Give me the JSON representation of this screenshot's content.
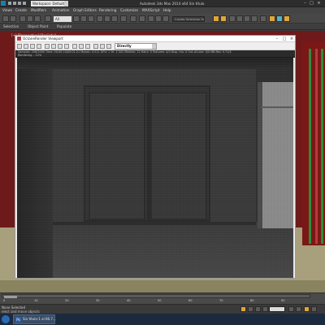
{
  "titlebar": {
    "workspace_value": "Workspace: Default",
    "app_title": "Autodesk 3ds Max 2014 x64    Sin título"
  },
  "menubar": {
    "items": [
      "Views",
      "Create",
      "Modifiers",
      "Animation",
      "Graph Editors",
      "Rendering",
      "Customize",
      "MAXScript",
      "Help"
    ]
  },
  "toolbar": {
    "selection_filter": "All",
    "named_selection_set": "Create Selection Se"
  },
  "ribbon": {
    "tabs": [
      "Selection",
      "Object Paint",
      "Populate"
    ]
  },
  "viewport": {
    "label": "[+] [Perspective] [Realistic]"
  },
  "octane": {
    "window_title": "OctaneRender Viewport",
    "kernel_value": "Directly",
    "stats_line1": "Samples: 256/2000  Time: 00:00:10/00:01:21  Ms/sec: 4.511  GPU: 1  Tri: 2.341  Meshes: 12  Hairs: 0  Textures: 4/0  Disp. tris: 0  Out-of-core: 0/0 MB  Res: 0.71/4",
    "stats_line2": "Rendering... 12%"
  },
  "timeline": {
    "ticks": [
      "0",
      "10",
      "20",
      "30",
      "40",
      "50",
      "60",
      "70",
      "80",
      "90"
    ]
  },
  "statusbar": {
    "line1": "None Selected",
    "line2": "elect and move objects"
  },
  "taskbar": {
    "item_label": "Sin título-1 al 66.7..."
  },
  "colors": {
    "accent_orange": "#e0a63a",
    "viewport_red": "#6e1a1a",
    "floor_tan": "#a89f7c"
  }
}
